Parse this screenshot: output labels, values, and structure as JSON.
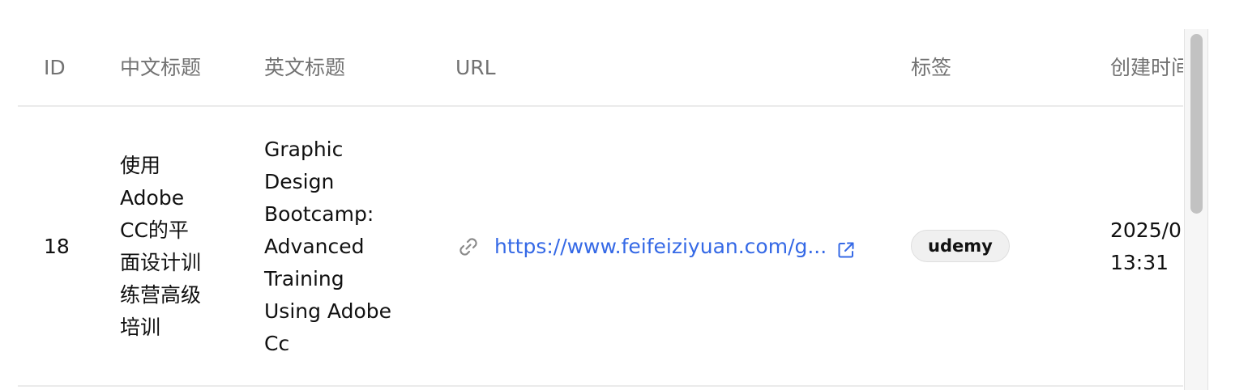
{
  "table": {
    "headers": {
      "id": "ID",
      "zh_title": "中文标题",
      "en_title": "英文标题",
      "url": "URL",
      "tags": "标签",
      "created_at": "创建时间"
    },
    "rows": [
      {
        "id": "18",
        "zh_title_lines": [
          "使用",
          "Adobe",
          "CC的平",
          "面设计训",
          "练营高级",
          "培训"
        ],
        "en_title_lines": [
          "Graphic",
          "Design",
          "Bootcamp:",
          "Advanced",
          "Training",
          "Using Adobe",
          "Cc"
        ],
        "url": "https://www.feifeiziyuan.com/g...",
        "url_icon": "link-icon",
        "external_icon": "external-link-icon",
        "tag": "udemy",
        "created_at_lines": [
          "2025/0",
          "13:31"
        ]
      }
    ]
  },
  "colors": {
    "link": "#3569e6",
    "header_text": "#727272",
    "divider": "#ebebeb",
    "tag_bg": "#f0f0f0"
  }
}
